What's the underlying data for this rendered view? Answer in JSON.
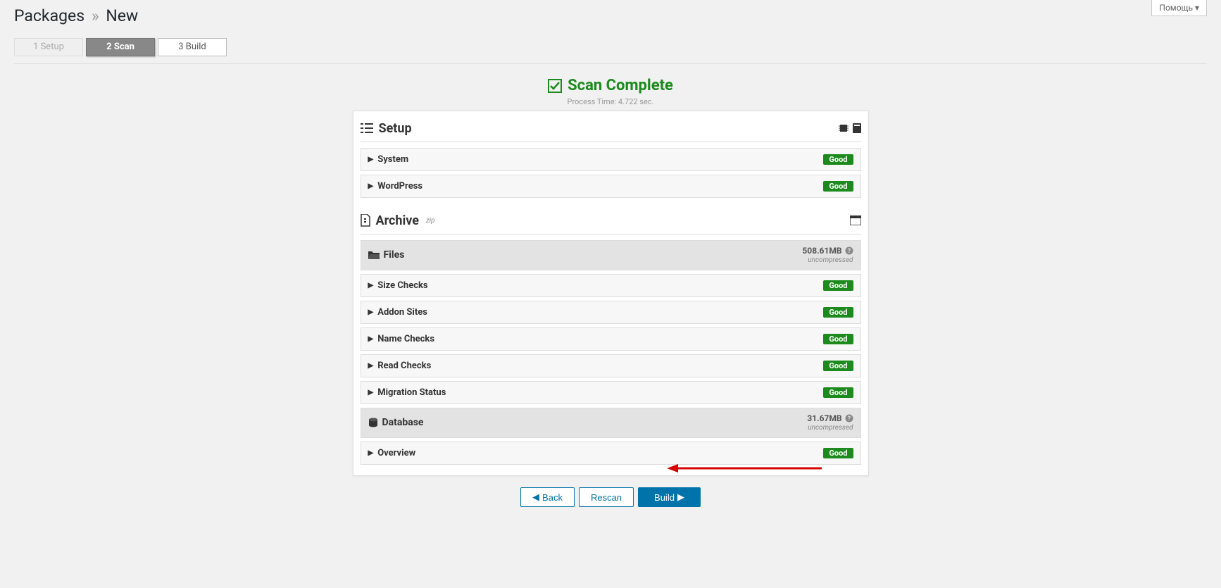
{
  "help_tab": "Помощь ▾",
  "page_title": {
    "main": "Packages",
    "sep": "»",
    "sub": "New"
  },
  "steps": [
    {
      "label": "1 Setup",
      "state": "disabled"
    },
    {
      "label": "2 Scan",
      "state": "active"
    },
    {
      "label": "3 Build",
      "state": "normal"
    }
  ],
  "scan": {
    "title": "Scan Complete",
    "subtitle": "Process Time: 4.722 sec."
  },
  "setup": {
    "title": "Setup",
    "rows": [
      {
        "label": "System",
        "badge": "Good"
      },
      {
        "label": "WordPress",
        "badge": "Good"
      }
    ]
  },
  "archive": {
    "title": "Archive",
    "sup": "zip",
    "files": {
      "label": "Files",
      "size": "508.61MB",
      "note": "uncompressed",
      "rows": [
        {
          "label": "Size Checks",
          "badge": "Good"
        },
        {
          "label": "Addon Sites",
          "badge": "Good"
        },
        {
          "label": "Name Checks",
          "badge": "Good"
        },
        {
          "label": "Read Checks",
          "badge": "Good"
        },
        {
          "label": "Migration Status",
          "badge": "Good"
        }
      ]
    },
    "database": {
      "label": "Database",
      "size": "31.67MB",
      "note": "uncompressed",
      "rows": [
        {
          "label": "Overview",
          "badge": "Good"
        }
      ]
    }
  },
  "buttons": {
    "back": "Back",
    "rescan": "Rescan",
    "build": "Build"
  }
}
